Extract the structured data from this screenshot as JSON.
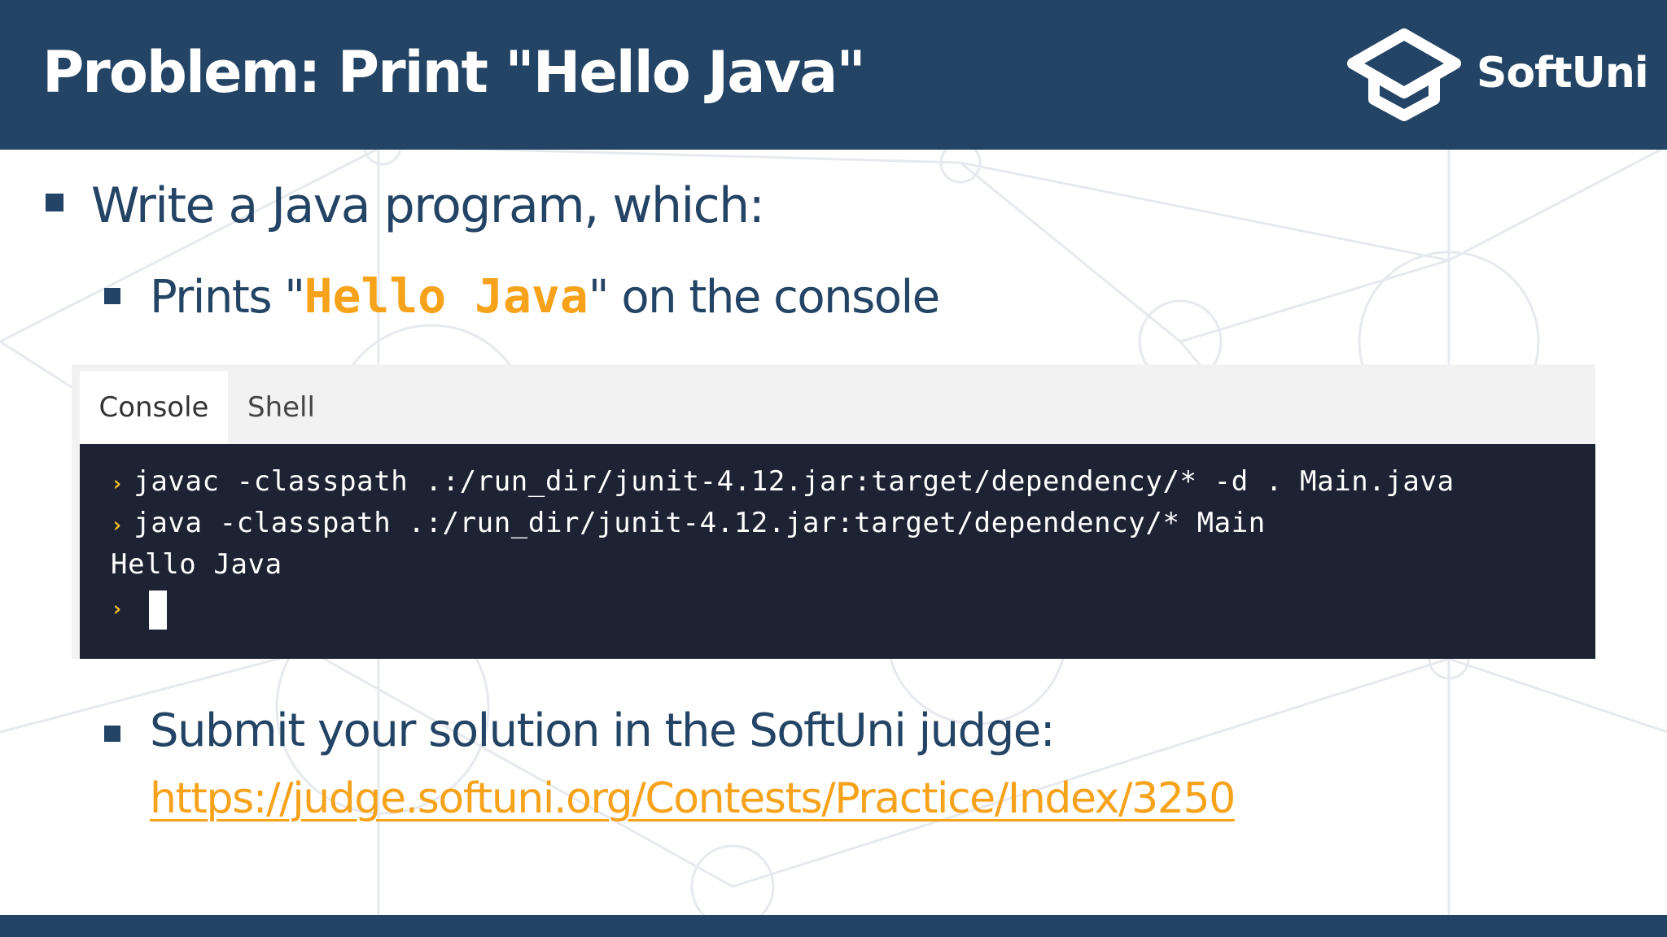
{
  "header": {
    "title": "Problem: Print \"Hello Java\"",
    "logo_text": "SoftUni"
  },
  "bullets": {
    "b1": "Write a Java program, which:",
    "b2_pre": "Prints \"",
    "b2_highlight": "Hello Java",
    "b2_post": "\" on the console",
    "b3": "Submit your solution in the SoftUni judge:",
    "link": "https://judge.softuni.org/Contests/Practice/Index/3250"
  },
  "console": {
    "tabs": [
      "Console",
      "Shell"
    ],
    "active_tab": "Console",
    "prompt_symbol": "›",
    "lines": [
      "javac -classpath .:/run_dir/junit-4.12.jar:target/dependency/* -d . Main.java",
      "java -classpath .:/run_dir/junit-4.12.jar:target/dependency/* Main"
    ],
    "output": "Hello Java"
  },
  "colors": {
    "brand_navy": "#234465",
    "accent_orange": "#f6a21b",
    "terminal_bg": "#1e2334",
    "prompt_yellow": "#f6c324"
  },
  "icons": {
    "logo": "graduation-cap-icon",
    "bullet": "square-bullet-icon",
    "prompt": "prompt-chevron-icon"
  }
}
